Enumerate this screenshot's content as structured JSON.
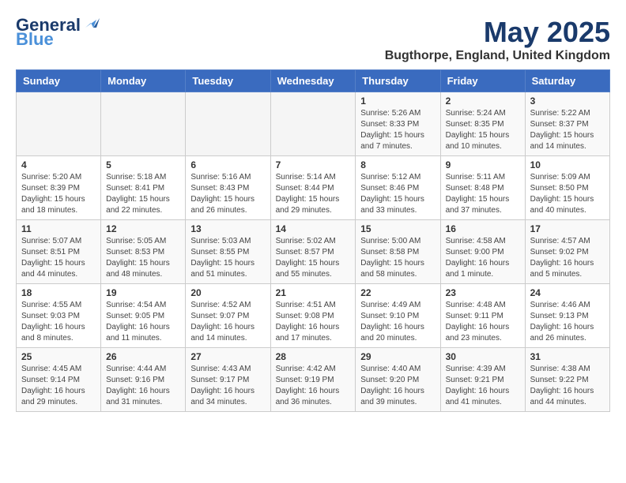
{
  "header": {
    "logo_line1": "General",
    "logo_line2": "Blue",
    "title": "May 2025",
    "subtitle": "Bugthorpe, England, United Kingdom"
  },
  "weekdays": [
    "Sunday",
    "Monday",
    "Tuesday",
    "Wednesday",
    "Thursday",
    "Friday",
    "Saturday"
  ],
  "weeks": [
    [
      {
        "day": "",
        "info": ""
      },
      {
        "day": "",
        "info": ""
      },
      {
        "day": "",
        "info": ""
      },
      {
        "day": "",
        "info": ""
      },
      {
        "day": "1",
        "info": "Sunrise: 5:26 AM\nSunset: 8:33 PM\nDaylight: 15 hours and 7 minutes."
      },
      {
        "day": "2",
        "info": "Sunrise: 5:24 AM\nSunset: 8:35 PM\nDaylight: 15 hours and 10 minutes."
      },
      {
        "day": "3",
        "info": "Sunrise: 5:22 AM\nSunset: 8:37 PM\nDaylight: 15 hours and 14 minutes."
      }
    ],
    [
      {
        "day": "4",
        "info": "Sunrise: 5:20 AM\nSunset: 8:39 PM\nDaylight: 15 hours and 18 minutes."
      },
      {
        "day": "5",
        "info": "Sunrise: 5:18 AM\nSunset: 8:41 PM\nDaylight: 15 hours and 22 minutes."
      },
      {
        "day": "6",
        "info": "Sunrise: 5:16 AM\nSunset: 8:43 PM\nDaylight: 15 hours and 26 minutes."
      },
      {
        "day": "7",
        "info": "Sunrise: 5:14 AM\nSunset: 8:44 PM\nDaylight: 15 hours and 29 minutes."
      },
      {
        "day": "8",
        "info": "Sunrise: 5:12 AM\nSunset: 8:46 PM\nDaylight: 15 hours and 33 minutes."
      },
      {
        "day": "9",
        "info": "Sunrise: 5:11 AM\nSunset: 8:48 PM\nDaylight: 15 hours and 37 minutes."
      },
      {
        "day": "10",
        "info": "Sunrise: 5:09 AM\nSunset: 8:50 PM\nDaylight: 15 hours and 40 minutes."
      }
    ],
    [
      {
        "day": "11",
        "info": "Sunrise: 5:07 AM\nSunset: 8:51 PM\nDaylight: 15 hours and 44 minutes."
      },
      {
        "day": "12",
        "info": "Sunrise: 5:05 AM\nSunset: 8:53 PM\nDaylight: 15 hours and 48 minutes."
      },
      {
        "day": "13",
        "info": "Sunrise: 5:03 AM\nSunset: 8:55 PM\nDaylight: 15 hours and 51 minutes."
      },
      {
        "day": "14",
        "info": "Sunrise: 5:02 AM\nSunset: 8:57 PM\nDaylight: 15 hours and 55 minutes."
      },
      {
        "day": "15",
        "info": "Sunrise: 5:00 AM\nSunset: 8:58 PM\nDaylight: 15 hours and 58 minutes."
      },
      {
        "day": "16",
        "info": "Sunrise: 4:58 AM\nSunset: 9:00 PM\nDaylight: 16 hours and 1 minute."
      },
      {
        "day": "17",
        "info": "Sunrise: 4:57 AM\nSunset: 9:02 PM\nDaylight: 16 hours and 5 minutes."
      }
    ],
    [
      {
        "day": "18",
        "info": "Sunrise: 4:55 AM\nSunset: 9:03 PM\nDaylight: 16 hours and 8 minutes."
      },
      {
        "day": "19",
        "info": "Sunrise: 4:54 AM\nSunset: 9:05 PM\nDaylight: 16 hours and 11 minutes."
      },
      {
        "day": "20",
        "info": "Sunrise: 4:52 AM\nSunset: 9:07 PM\nDaylight: 16 hours and 14 minutes."
      },
      {
        "day": "21",
        "info": "Sunrise: 4:51 AM\nSunset: 9:08 PM\nDaylight: 16 hours and 17 minutes."
      },
      {
        "day": "22",
        "info": "Sunrise: 4:49 AM\nSunset: 9:10 PM\nDaylight: 16 hours and 20 minutes."
      },
      {
        "day": "23",
        "info": "Sunrise: 4:48 AM\nSunset: 9:11 PM\nDaylight: 16 hours and 23 minutes."
      },
      {
        "day": "24",
        "info": "Sunrise: 4:46 AM\nSunset: 9:13 PM\nDaylight: 16 hours and 26 minutes."
      }
    ],
    [
      {
        "day": "25",
        "info": "Sunrise: 4:45 AM\nSunset: 9:14 PM\nDaylight: 16 hours and 29 minutes."
      },
      {
        "day": "26",
        "info": "Sunrise: 4:44 AM\nSunset: 9:16 PM\nDaylight: 16 hours and 31 minutes."
      },
      {
        "day": "27",
        "info": "Sunrise: 4:43 AM\nSunset: 9:17 PM\nDaylight: 16 hours and 34 minutes."
      },
      {
        "day": "28",
        "info": "Sunrise: 4:42 AM\nSunset: 9:19 PM\nDaylight: 16 hours and 36 minutes."
      },
      {
        "day": "29",
        "info": "Sunrise: 4:40 AM\nSunset: 9:20 PM\nDaylight: 16 hours and 39 minutes."
      },
      {
        "day": "30",
        "info": "Sunrise: 4:39 AM\nSunset: 9:21 PM\nDaylight: 16 hours and 41 minutes."
      },
      {
        "day": "31",
        "info": "Sunrise: 4:38 AM\nSunset: 9:22 PM\nDaylight: 16 hours and 44 minutes."
      }
    ]
  ]
}
